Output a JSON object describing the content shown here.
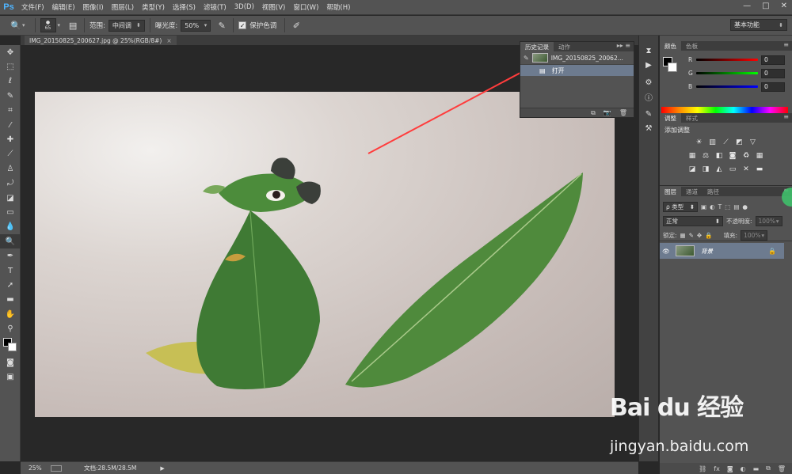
{
  "app": {
    "logo": "Ps",
    "win_controls": [
      "—",
      "□",
      "✕"
    ]
  },
  "menu": [
    "文件(F)",
    "编辑(E)",
    "图像(I)",
    "图层(L)",
    "类型(Y)",
    "选择(S)",
    "滤镜(T)",
    "3D(D)",
    "视图(V)",
    "窗口(W)",
    "帮助(H)"
  ],
  "options": {
    "brush_size": "65",
    "range_label": "范围:",
    "range_value": "中间调",
    "exposure_label": "曝光度:",
    "exposure_value": "50%",
    "protect_tones": "保护色调",
    "workspace": "基本功能"
  },
  "document": {
    "tab_title": "IMG_20150825_200627.jpg @ 25%(RGB/8#)",
    "close": "×"
  },
  "status": {
    "zoom": "25%",
    "doc_info": "文档:28.5M/28.5M"
  },
  "history": {
    "tabs": [
      "历史记录",
      "动作"
    ],
    "snapshot": "IMG_20150825_20062...",
    "state": "打开"
  },
  "color_panel": {
    "tabs": [
      "颜色",
      "色板"
    ],
    "r_label": "R",
    "g_label": "G",
    "b_label": "B",
    "r": "0",
    "g": "0",
    "b": "0"
  },
  "adjust_panel": {
    "tabs": [
      "调整",
      "样式"
    ],
    "add_label": "添加调整"
  },
  "layers_panel": {
    "tabs": [
      "图层",
      "通道",
      "路径"
    ],
    "filter_kind": "ρ 类型",
    "blend_mode": "正常",
    "opacity_label": "不透明度:",
    "opacity_value": "100%",
    "lock_label": "锁定:",
    "fill_label": "填充:",
    "fill_value": "100%",
    "layer_name": "背景"
  },
  "watermark": {
    "brand": "Bai du 经验",
    "url": "jingyan.baidu.com"
  },
  "colors": {
    "ps_blue": "#4fb4ff",
    "annotation_arrow": "#ff3c3c",
    "selection": "#6d7b8f"
  }
}
